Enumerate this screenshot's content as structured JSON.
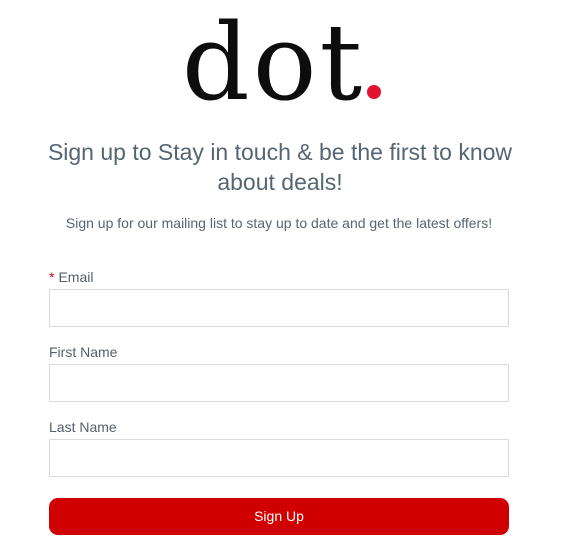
{
  "brand": {
    "logo_text": "dot",
    "accent_color": "#e0142c"
  },
  "headline": "Sign up to Stay in touch & be the first to know about deals!",
  "subheadline": "Sign up for our mailing list to stay up to date and get the latest offers!",
  "form": {
    "email": {
      "required_marker": "*",
      "label": "Email",
      "value": "",
      "placeholder": ""
    },
    "first_name": {
      "label": "First Name",
      "value": "",
      "placeholder": ""
    },
    "last_name": {
      "label": "Last Name",
      "value": "",
      "placeholder": ""
    },
    "submit_label": "Sign Up",
    "submit_color": "#d00000"
  }
}
